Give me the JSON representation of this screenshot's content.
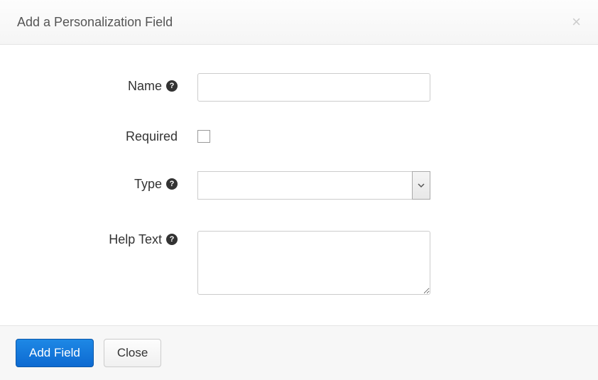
{
  "header": {
    "title": "Add a Personalization Field"
  },
  "form": {
    "name": {
      "label": "Name",
      "value": ""
    },
    "required": {
      "label": "Required",
      "checked": false
    },
    "type": {
      "label": "Type",
      "value": ""
    },
    "help_text": {
      "label": "Help Text",
      "value": ""
    }
  },
  "footer": {
    "add_field_label": "Add Field",
    "close_label": "Close"
  }
}
